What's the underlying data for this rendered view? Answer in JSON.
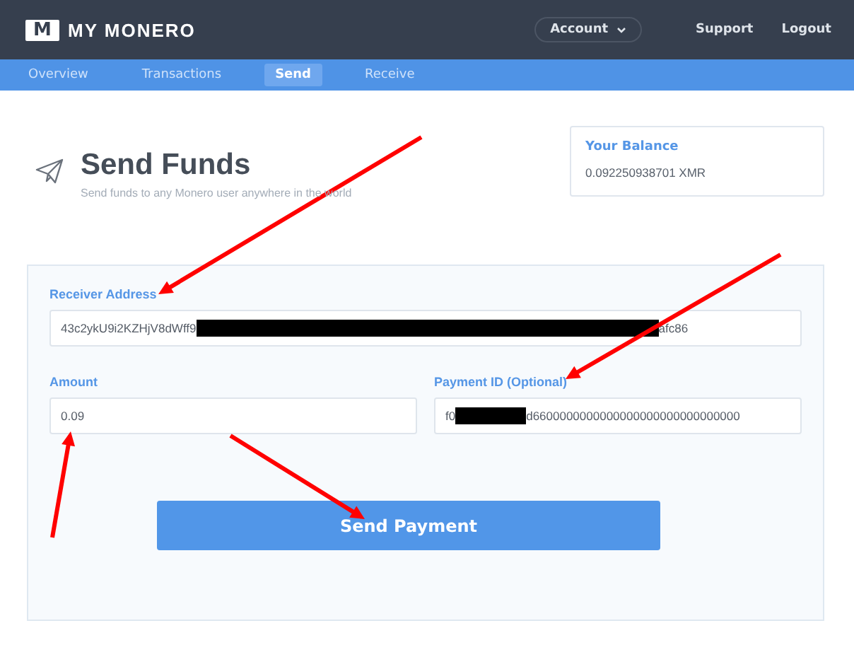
{
  "header": {
    "logo_mark": "M",
    "brand": "MY MONERO",
    "account": "Account",
    "links": [
      "Support",
      "Logout"
    ]
  },
  "tabs": [
    {
      "label": "Overview",
      "selected": false
    },
    {
      "label": "Transactions",
      "selected": false
    },
    {
      "label": "Send",
      "selected": true
    },
    {
      "label": "Receive",
      "selected": false
    }
  ],
  "page": {
    "title": "Send Funds",
    "subtitle": "Send funds to any Monero user anywhere in the world"
  },
  "balance": {
    "label": "Your Balance",
    "value": "0.092250938701 XMR"
  },
  "form": {
    "receiver": {
      "label": "Receiver Address",
      "value_start": "43c2ykU9i2KZHjV8dWff9",
      "value_end": "afc86"
    },
    "amount": {
      "label": "Amount",
      "value": "0.09"
    },
    "payment_id": {
      "label": "Payment ID (Optional)",
      "value_start": "f0",
      "value_end": "d6600000000000000000000000000000"
    },
    "submit": "Send Payment"
  }
}
